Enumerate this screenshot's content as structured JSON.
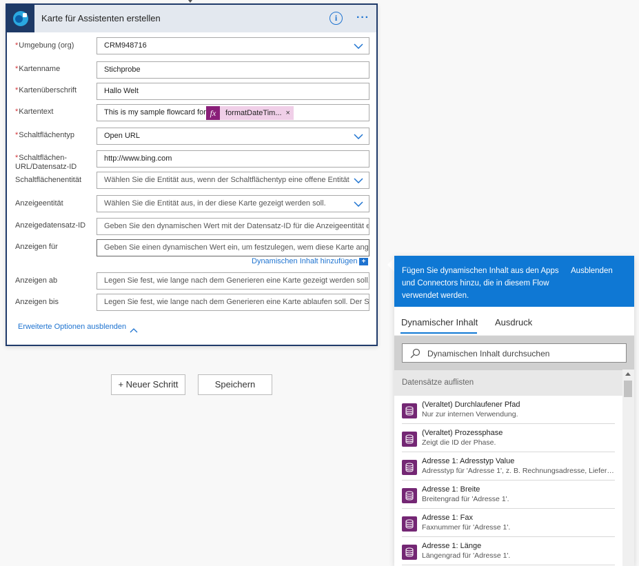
{
  "card": {
    "title": "Karte für Assistenten erstellen",
    "fields": {
      "umgebung": {
        "label": "Umgebung (org)",
        "value": "CRM948716",
        "required": true
      },
      "kartenname": {
        "label": "Kartenname",
        "value": "Stichprobe",
        "required": true
      },
      "kartenueberschrift": {
        "label": "Kartenüberschrift",
        "value": "Hallo Welt",
        "required": true
      },
      "kartentext": {
        "label": "Kartentext",
        "value": "This is my sample flowcard for",
        "token": "formatDateTim...",
        "token_close": "×",
        "required": true
      },
      "schaltflaechentyp": {
        "label": "Schaltflächentyp",
        "value": "Open URL",
        "required": true
      },
      "schaltflaechen_url": {
        "label": "Schaltflächen-URL/Datensatz-ID",
        "value": "http://www.bing.com",
        "required": true
      },
      "schaltflaechenentitaet": {
        "label": "Schaltflächenentität",
        "placeholder": "Wählen Sie die Entität aus, wenn der Schaltflächentyp eine offene Entität"
      },
      "anzeigeentitaet": {
        "label": "Anzeigeentität",
        "placeholder": "Wählen Sie die Entität aus, in der diese Karte gezeigt werden soll."
      },
      "anzeigedatensatz": {
        "label": "Anzeigedatensatz-ID",
        "placeholder": "Geben Sie den dynamischen Wert mit der Datensatz-ID für die Anzeigeentität e"
      },
      "anzeigen_fuer": {
        "label": "Anzeigen für",
        "placeholder": "Geben Sie einen dynamischen Wert ein, um festzulegen, wem diese Karte ange"
      },
      "anzeigen_ab": {
        "label": "Anzeigen ab",
        "placeholder": "Legen Sie fest, wie lange nach dem Generieren eine Karte gezeigt werden soll. I"
      },
      "anzeigen_bis": {
        "label": "Anzeigen bis",
        "placeholder": "Legen Sie fest, wie lange nach dem Generieren eine Karte ablaufen soll. Der Sta"
      }
    },
    "dynamic_link": "Dynamischen Inhalt hinzufügen",
    "advanced_link": "Erweiterte Optionen ausblenden"
  },
  "buttons": {
    "new_step": "+ Neuer Schritt",
    "save": "Speichern"
  },
  "panel": {
    "message": "Fügen Sie dynamischen Inhalt aus den Apps und Connectors hinzu, die in diesem Flow verwendet werden.",
    "hide_label": "Ausblenden",
    "tabs": [
      "Dynamischer Inhalt",
      "Ausdruck"
    ],
    "search_placeholder": "Dynamischen Inhalt durchsuchen",
    "section_title": "Datensätze auflisten",
    "items": [
      {
        "title": "(Veraltet) Durchlaufener Pfad",
        "desc": "Nur zur internen Verwendung."
      },
      {
        "title": "(Veraltet) Prozessphase",
        "desc": "Zeigt die ID der Phase."
      },
      {
        "title": "Adresse 1: Adresstyp Value",
        "desc": "Adresstyp für 'Adresse 1', z. B. Rechnungsadresse, Liefera..."
      },
      {
        "title": "Adresse 1: Breite",
        "desc": "Breitengrad für 'Adresse 1'."
      },
      {
        "title": "Adresse 1: Fax",
        "desc": "Faxnummer für 'Adresse 1'."
      },
      {
        "title": "Adresse 1: Länge",
        "desc": "Längengrad für 'Adresse 1'."
      }
    ]
  },
  "colors": {
    "accent": "#0f78d4",
    "header_bg": "#e3e8ef",
    "card_border": "#1f3a6a",
    "token_bg": "#f0cfe8",
    "token_fx": "#8a1f79",
    "item_icon": "#742774"
  }
}
